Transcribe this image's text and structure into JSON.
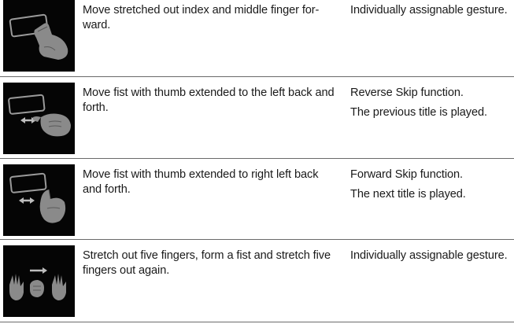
{
  "rows": [
    {
      "icon": "index-middle-finger-forward-gesture-icon",
      "description": "Move stretched out index and middle finger for-ward.",
      "description_lines": [
        "Move stretched out index and middle finger for-",
        "ward."
      ],
      "function_lines": [
        "Individually assignable gesture."
      ]
    },
    {
      "icon": "thumb-left-swipe-gesture-icon",
      "description_lines": [
        "Move fist with thumb extended to the left back and",
        "forth."
      ],
      "function_lines": [
        "Reverse Skip function.",
        "The previous title is played."
      ]
    },
    {
      "icon": "thumb-right-swipe-gesture-icon",
      "description_lines": [
        "Move fist with thumb extended to right left back",
        "and forth."
      ],
      "function_lines": [
        "Forward Skip function.",
        "The next title is played."
      ]
    },
    {
      "icon": "five-fingers-fist-gesture-icon",
      "description_lines": [
        "Stretch out five fingers, form a fist and stretch five",
        "fingers out again."
      ],
      "function_lines": [
        "Individually assignable gesture."
      ]
    }
  ]
}
